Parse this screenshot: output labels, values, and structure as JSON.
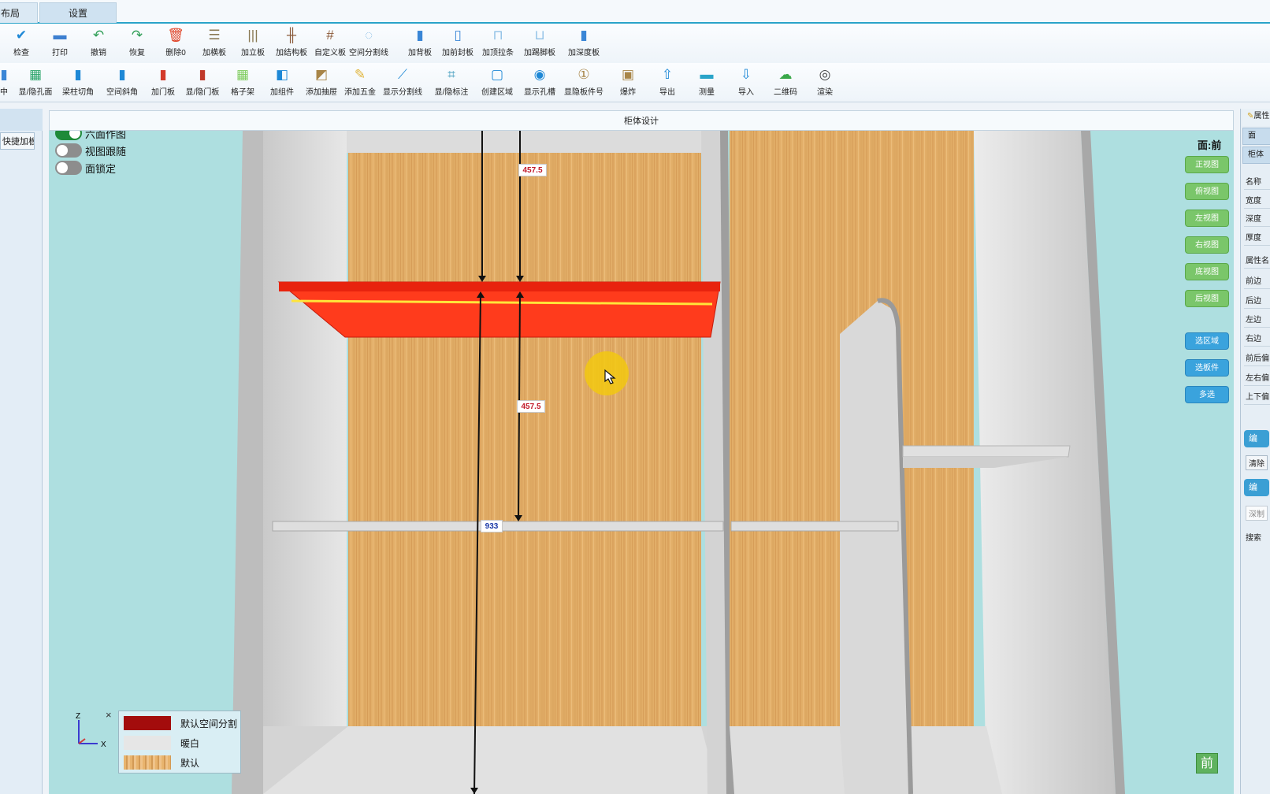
{
  "tabs": [
    {
      "label": "布局"
    },
    {
      "label": "设置"
    }
  ],
  "toolbar1": [
    {
      "label": "检查",
      "icon": "check-icon"
    },
    {
      "label": "打印",
      "icon": "printer-icon"
    },
    {
      "label": "撤销",
      "icon": "undo-icon"
    },
    {
      "label": "恢复",
      "icon": "redo-icon"
    },
    {
      "label": "删除0",
      "icon": "trash-icon"
    },
    {
      "label": "加横板",
      "icon": "horizontal-board-icon"
    },
    {
      "label": "加立板",
      "icon": "vertical-board-icon"
    },
    {
      "label": "加结构板",
      "icon": "structure-board-icon"
    },
    {
      "label": "自定义板",
      "icon": "custom-board-icon"
    },
    {
      "label": "空间分割线",
      "icon": "space-divider-icon"
    },
    {
      "label": "加背板",
      "icon": "back-board-icon"
    },
    {
      "label": "加前封板",
      "icon": "front-seal-board-icon"
    },
    {
      "label": "加顶拉条",
      "icon": "top-strip-icon"
    },
    {
      "label": "加踢脚板",
      "icon": "kick-board-icon"
    },
    {
      "label": "加深度板",
      "icon": "depth-board-icon"
    }
  ],
  "toolbar2": [
    {
      "label": "中",
      "icon": "center-icon"
    },
    {
      "label": "显/隐孔面",
      "icon": "hole-face-icon"
    },
    {
      "label": "梁柱切角",
      "icon": "beam-cut-icon"
    },
    {
      "label": "空间斜角",
      "icon": "space-bevel-icon"
    },
    {
      "label": "加门板",
      "icon": "door-panel-icon"
    },
    {
      "label": "显/隐门板",
      "icon": "toggle-door-icon"
    },
    {
      "label": "格子架",
      "icon": "grid-shelf-icon"
    },
    {
      "label": "加组件",
      "icon": "component-icon"
    },
    {
      "label": "添加抽屉",
      "icon": "drawer-icon"
    },
    {
      "label": "添加五金",
      "icon": "hardware-icon"
    },
    {
      "label": "显示分割线",
      "icon": "show-divider-icon"
    },
    {
      "label": "显/隐标注",
      "icon": "annotation-icon"
    },
    {
      "label": "创建区域",
      "icon": "create-region-icon"
    },
    {
      "label": "显示孔槽",
      "icon": "hole-slot-icon"
    },
    {
      "label": "显隐板件号",
      "icon": "board-number-icon"
    },
    {
      "label": "爆炸",
      "icon": "explode-icon"
    },
    {
      "label": "导出",
      "icon": "export-icon"
    },
    {
      "label": "测量",
      "icon": "measure-icon"
    },
    {
      "label": "导入",
      "icon": "import-icon"
    },
    {
      "label": "二维码",
      "icon": "qr-cloud-icon"
    },
    {
      "label": "渲染",
      "icon": "render-icon"
    }
  ],
  "left_panel": {
    "quick_add": "快捷加板"
  },
  "design": {
    "title": "柜体设计",
    "face_label": "面:前",
    "front_badge": "前"
  },
  "toggles": [
    {
      "label": "六面作图",
      "on": true
    },
    {
      "label": "视图跟随",
      "on": false
    },
    {
      "label": "面锁定",
      "on": false
    }
  ],
  "view_buttons": [
    {
      "label": "正视图",
      "style": "green"
    },
    {
      "label": "俯视图",
      "style": "green"
    },
    {
      "label": "左视图",
      "style": "green"
    },
    {
      "label": "右视图",
      "style": "green"
    },
    {
      "label": "底视图",
      "style": "green"
    },
    {
      "label": "后视图",
      "style": "green"
    },
    {
      "label": "选区域",
      "style": "blue"
    },
    {
      "label": "选板件",
      "style": "blue"
    },
    {
      "label": "多选",
      "style": "blue"
    }
  ],
  "dimensions": {
    "upper": "457.5",
    "lower": "457.5",
    "shelf": "933"
  },
  "legend": [
    {
      "label": "默认空间分割",
      "color": "#a30c0c"
    },
    {
      "label": "暖白",
      "color": "#e6e6e6"
    },
    {
      "label": "默认",
      "color": "#e3b070"
    }
  ],
  "axis": {
    "z": "Z",
    "x": "X"
  },
  "right_panel": {
    "title": "属性",
    "tabs": [
      "面",
      "柜体"
    ],
    "fields": [
      "名称",
      "宽度",
      "深度",
      "厚度",
      "属性名",
      "前边",
      "后边",
      "左边",
      "右边",
      "前后偏",
      "左右偏",
      "上下偏"
    ],
    "edit_button_1": "编",
    "clear_button": "清除",
    "edit_button_2": "编",
    "depth_input": "深制",
    "search_label": "搜索"
  },
  "colors": {
    "accent": "#2aa4c9",
    "viewport_bg": "#aedfe0",
    "selected_board": "#ff3a1a",
    "wood": "#e4b06a"
  }
}
